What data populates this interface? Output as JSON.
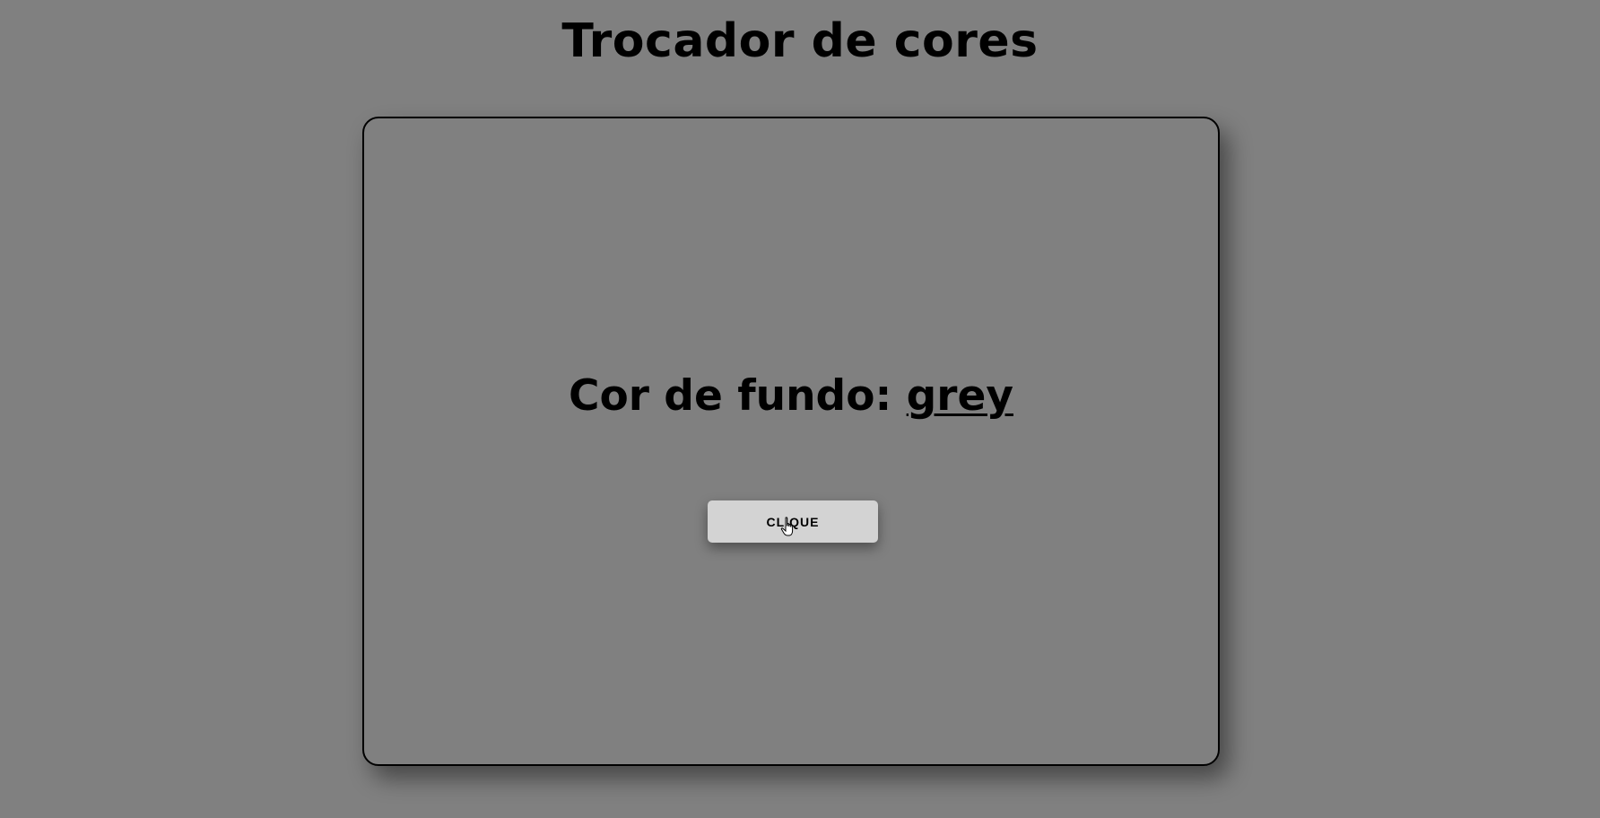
{
  "header": {
    "title": "Trocador de cores"
  },
  "card": {
    "label_prefix": "Cor de fundo: ",
    "color_name": "grey",
    "button_label": "CLIQUE"
  },
  "colors": {
    "background": "#808080",
    "button": "#d3d3d3",
    "text": "#000000"
  },
  "icons": {
    "cursor": "hand-pointer-icon"
  }
}
